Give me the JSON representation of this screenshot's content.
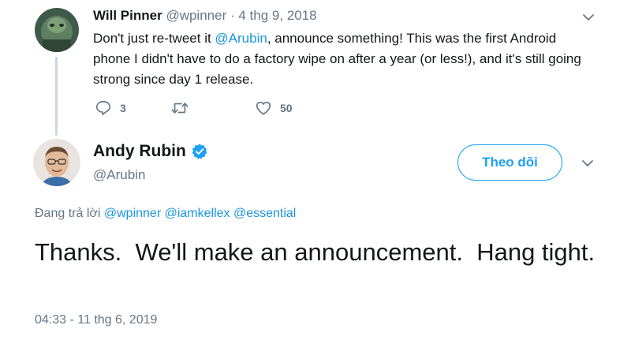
{
  "reply_tweet": {
    "author_name": "Will Pinner",
    "meta": "@wpinner · 4 thg 9, 2018",
    "text_before": "Don't just re-tweet it ",
    "mention": "@Arubin",
    "text_after": ", announce something! This was the first Android phone I didn't have to do a factory wipe on after a year (or less!), and it's still going strong since day 1 release.",
    "reply_count": "3",
    "retweet_count": "",
    "like_count": "50"
  },
  "main_tweet": {
    "author_name": "Andy Rubin",
    "handle": "@Arubin",
    "follow_label": "Theo dõi",
    "replying_label": "Đang trả lời",
    "replying_mentions": "@wpinner @iamkellex @essential",
    "text": "Thanks.  We'll make an announcement.  Hang tight.",
    "timestamp": "04:33 - 11 thg 6, 2019"
  },
  "icons": {
    "reply": "reply-icon",
    "retweet": "retweet-icon",
    "like": "heart-icon",
    "verified": "verified-badge-icon",
    "more": "chevron-down-icon"
  },
  "colors": {
    "link": "#1b95e0",
    "follow": "#1da1f2",
    "secondary_text": "#657786"
  }
}
